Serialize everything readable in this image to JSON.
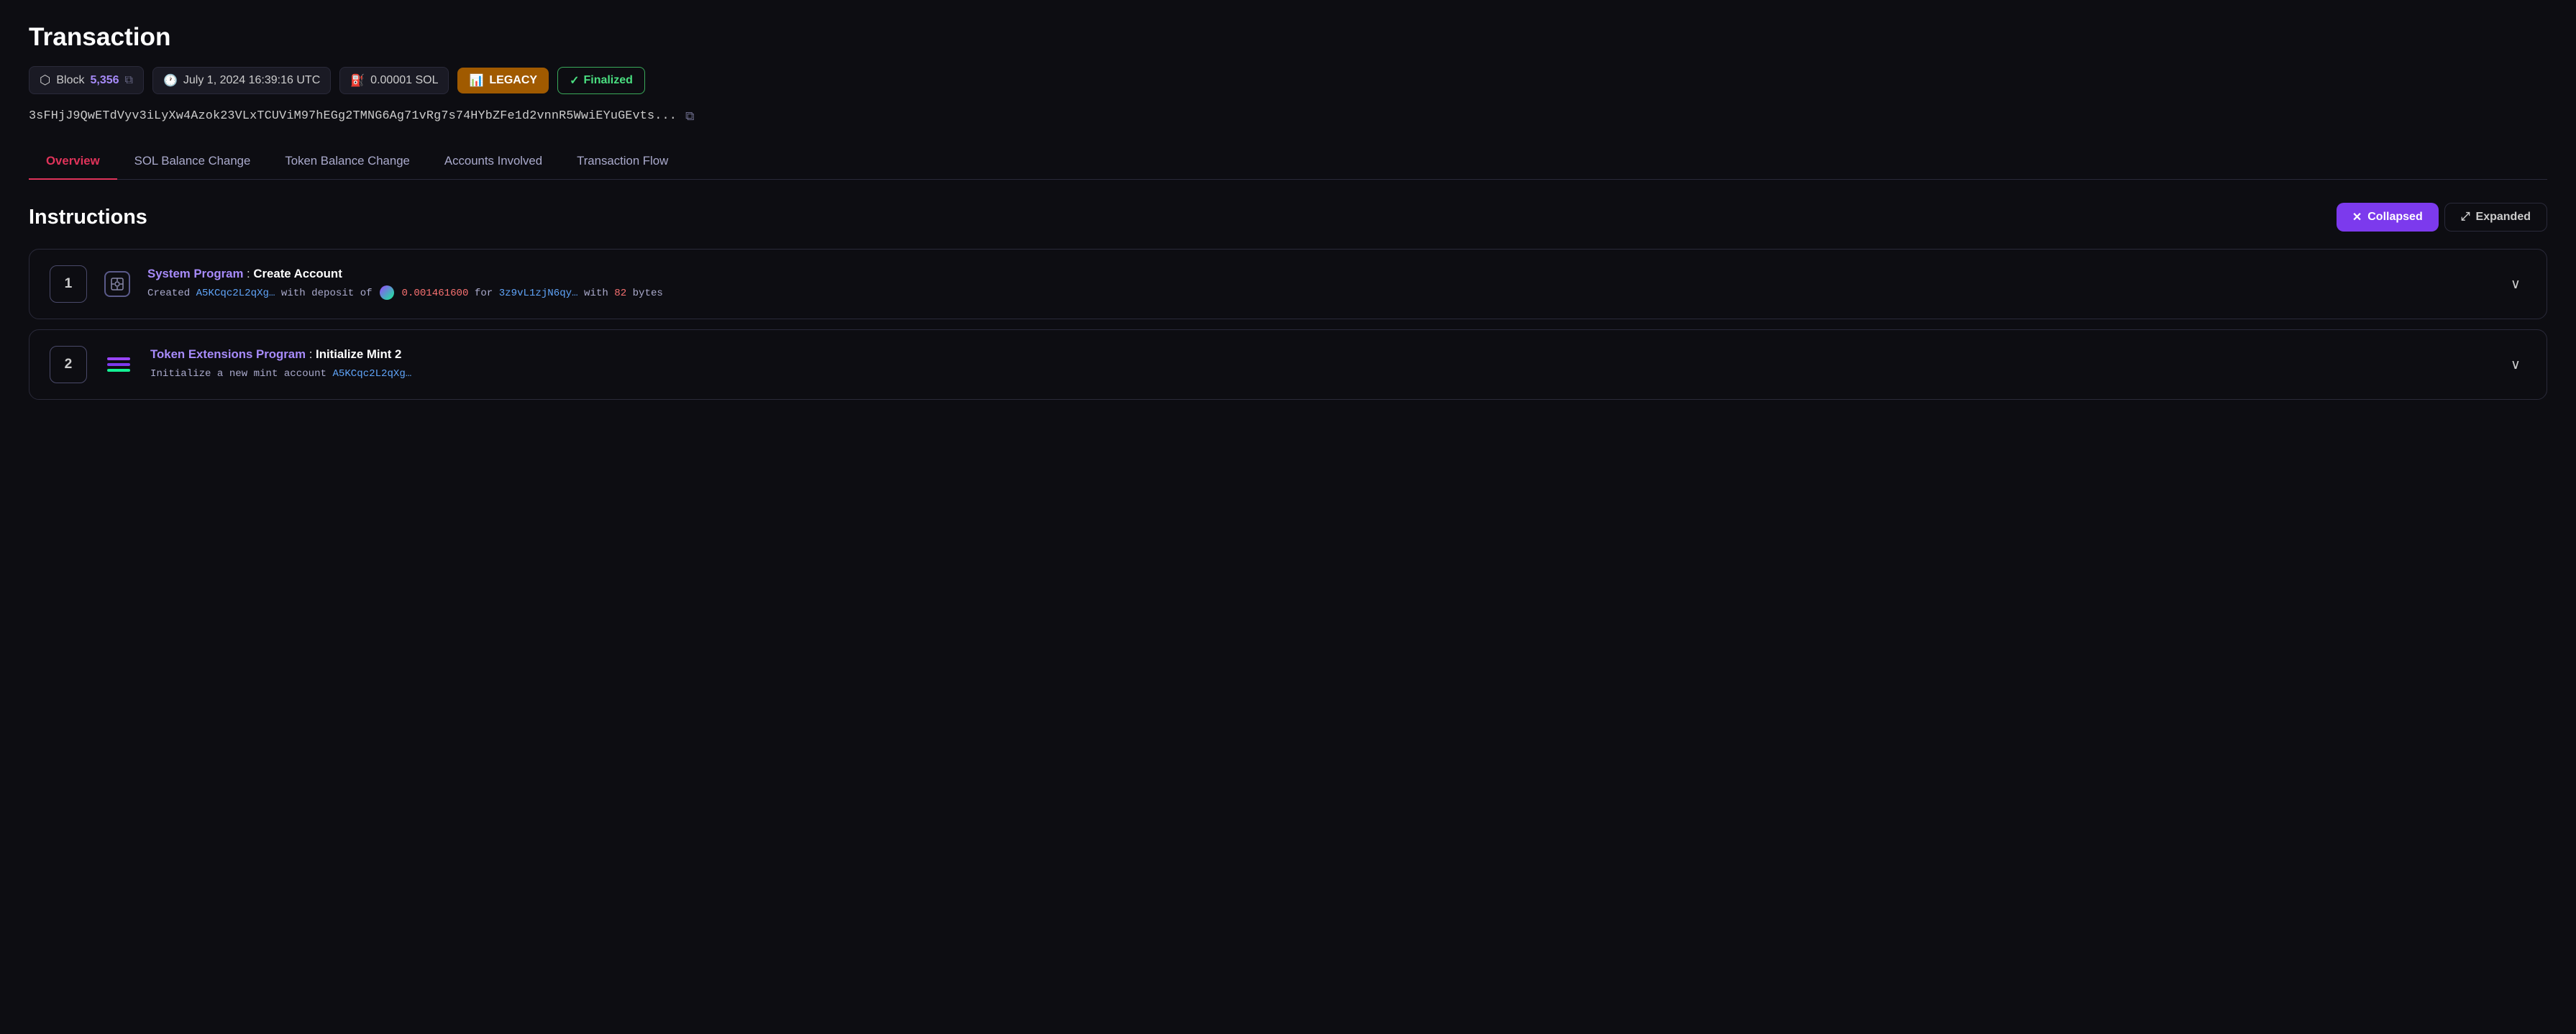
{
  "page": {
    "title": "Transaction"
  },
  "meta": {
    "block_label": "Block",
    "block_number": "5,356",
    "date": "July 1, 2024 16:39:16 UTC",
    "fee": "0.00001 SOL",
    "type": "LEGACY",
    "status": "Finalized"
  },
  "tx_hash": "3sFHjJ9QwETdVyv3iLyXw4Azok23VLxTCUViM97hEGg2TMNG6Ag71vRg7s74HYbZFe1d2vnnR5WwiEYuGEvts...",
  "tabs": [
    {
      "id": "overview",
      "label": "Overview",
      "active": true
    },
    {
      "id": "sol-balance",
      "label": "SOL Balance Change",
      "active": false
    },
    {
      "id": "token-balance",
      "label": "Token Balance Change",
      "active": false
    },
    {
      "id": "accounts",
      "label": "Accounts Involved",
      "active": false
    },
    {
      "id": "flow",
      "label": "Transaction Flow",
      "active": false
    }
  ],
  "instructions": {
    "section_title": "Instructions",
    "collapsed_label": "Collapsed",
    "expanded_label": "Expanded",
    "items": [
      {
        "num": "1",
        "program": "System Program",
        "method": "Create Account",
        "desc_prefix": "Created",
        "addr1": "A5KCqc2L2qXg…",
        "desc_mid1": "with deposit of",
        "amount": "0.001461600",
        "desc_mid2": "for",
        "addr2": "3z9vL1zjN6qy…",
        "desc_mid3": "with",
        "bytes_num": "82",
        "desc_suffix": "bytes"
      },
      {
        "num": "2",
        "program": "Token Extensions Program",
        "method": "Initialize Mint 2",
        "desc_prefix": "Initialize a new mint account",
        "addr1": "A5KCqc2L2qXg…",
        "desc_suffix": ""
      }
    ]
  }
}
